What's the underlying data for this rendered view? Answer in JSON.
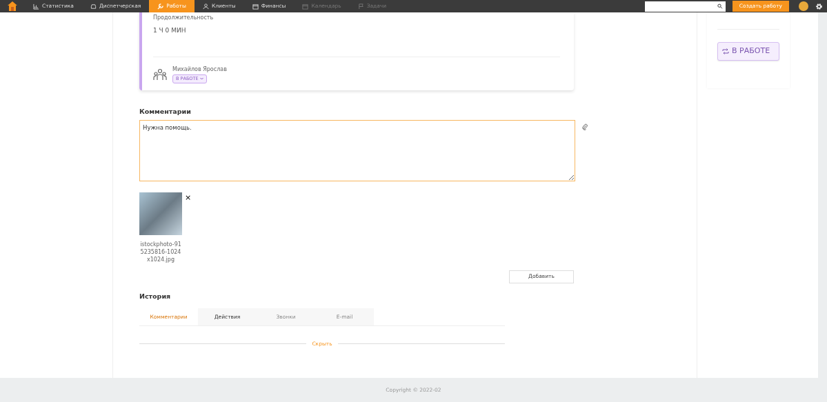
{
  "navbar": {
    "items": [
      {
        "label": "Статистика",
        "selected": false,
        "disabled": false
      },
      {
        "label": "Диспетчерская",
        "selected": false,
        "disabled": false
      },
      {
        "label": "Работы",
        "selected": true,
        "disabled": false
      },
      {
        "label": "Клиенты",
        "selected": false,
        "disabled": false
      },
      {
        "label": "Финансы",
        "selected": false,
        "disabled": false
      },
      {
        "label": "Календарь",
        "selected": false,
        "disabled": true
      },
      {
        "label": "Задачи",
        "selected": false,
        "disabled": true
      }
    ],
    "create_button": "Создать работу"
  },
  "job_card": {
    "duration_label": "Продолжительность",
    "duration": "1 Ч 0 МИН",
    "assignee": "Михайлов Ярослав",
    "assignee_status": "В РАБОТЕ"
  },
  "comments": {
    "title": "Комментарии",
    "value": "Нужна помощь.",
    "attachments": [
      {
        "file_name": "istockphoto-915235816-1024x1024.jpg",
        "remove": "×"
      }
    ],
    "add_button": "Добавить"
  },
  "history": {
    "title": "История",
    "tabs": [
      {
        "label": "Комментарии",
        "selected": true,
        "disabled": false
      },
      {
        "label": "Действия",
        "selected": false,
        "disabled": false
      },
      {
        "label": "Звонки",
        "selected": false,
        "disabled": true
      },
      {
        "label": "E-mail",
        "selected": false,
        "disabled": true
      }
    ],
    "hide_link": "Скрыть"
  },
  "sidebar": {
    "status": "В РАБОТЕ"
  },
  "footer": {
    "copyright": "Copyright © 2022-02"
  }
}
